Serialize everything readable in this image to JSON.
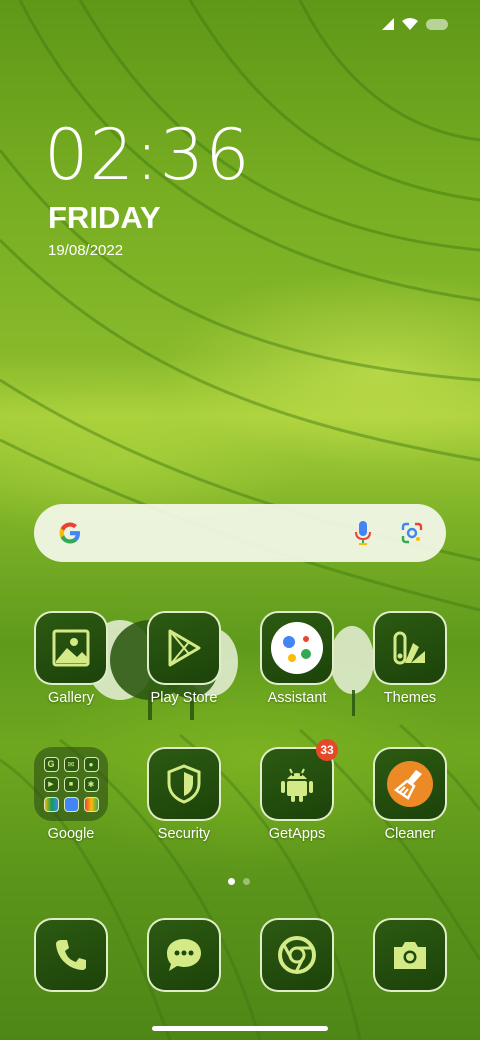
{
  "clock": {
    "time": "02:36",
    "day": "FRIDAY",
    "date": "19/08/2022"
  },
  "search": {
    "google_icon": "google-g-icon",
    "mic_icon": "mic-icon",
    "lens_icon": "lens-icon"
  },
  "apps": [
    {
      "label": "Gallery",
      "icon": "gallery-icon"
    },
    {
      "label": "Play Store",
      "icon": "play-store-icon"
    },
    {
      "label": "Assistant",
      "icon": "assistant-icon"
    },
    {
      "label": "Themes",
      "icon": "themes-icon"
    },
    {
      "label": "Google",
      "icon": "folder-icon"
    },
    {
      "label": "Security",
      "icon": "shield-icon"
    },
    {
      "label": "GetApps",
      "icon": "android-icon",
      "badge": "33"
    },
    {
      "label": "Cleaner",
      "icon": "broom-icon"
    }
  ],
  "dock": [
    {
      "icon": "phone-icon"
    },
    {
      "icon": "messages-icon"
    },
    {
      "icon": "chrome-icon"
    },
    {
      "icon": "camera-icon"
    }
  ],
  "page_indicator": {
    "pages": 2,
    "current": 1
  },
  "colors": {
    "tile": "#1f4a0c",
    "tile_border": "#ebf5d2",
    "badge": "#e8482a",
    "icon_accent": "#d4ea86"
  }
}
